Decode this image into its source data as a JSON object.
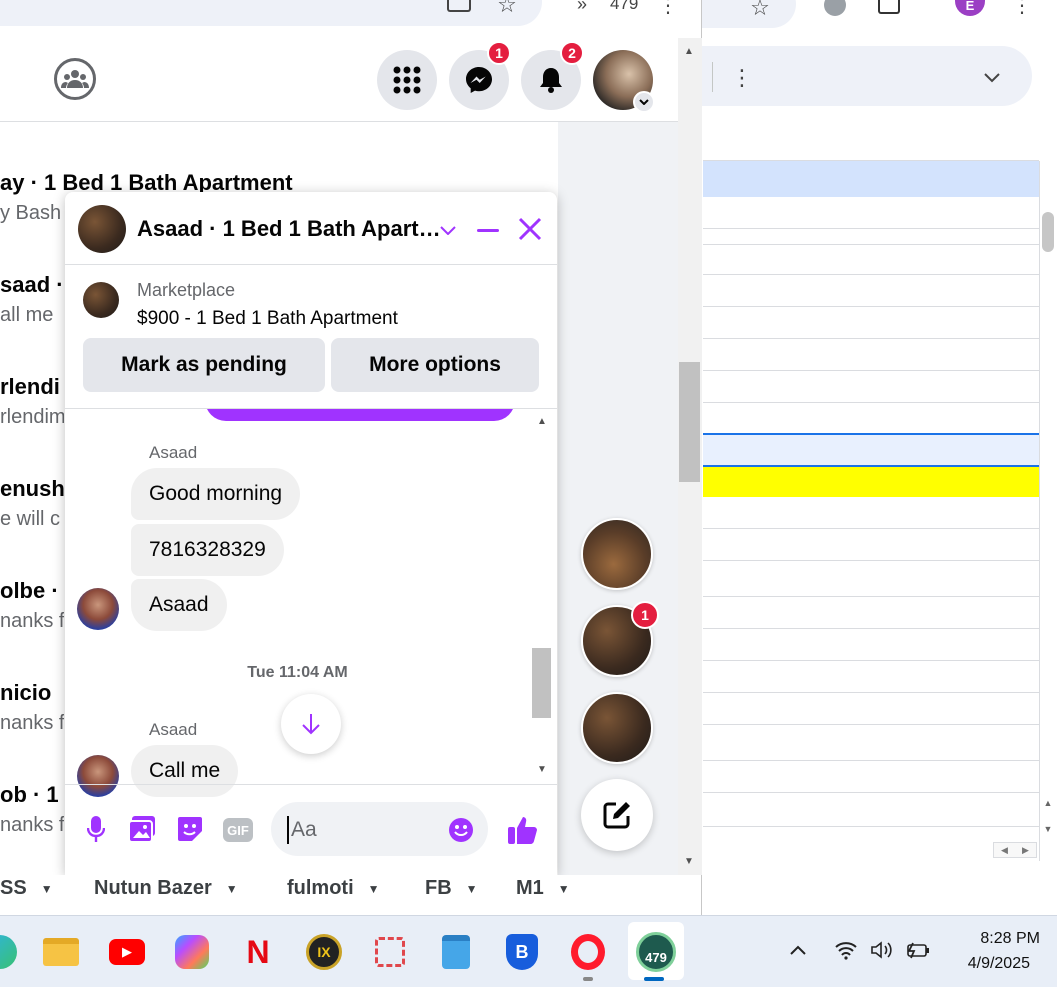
{
  "browser": {
    "tab_count": "479",
    "avatar_letter": "E"
  },
  "right_sheet": {
    "accent": "#1a73e8",
    "highlight": "#ffff00",
    "header_band": "#d3e3fd"
  },
  "messenger_list": [
    {
      "title": "ay · 1 Bed 1 Bath Apartment",
      "snippet": "y Bash"
    },
    {
      "title": "saad ·",
      "snippet": "all me"
    },
    {
      "title": "rlendi",
      "snippet": "rlendim"
    },
    {
      "title": "enush",
      "snippet": "e will c"
    },
    {
      "title": "olbe ·",
      "snippet": "nanks fo"
    },
    {
      "title": "nicio",
      "snippet": "nanks fo"
    },
    {
      "title": "ob · 1",
      "snippet": "nanks fo"
    }
  ],
  "topnav": {
    "messenger_badge": "1",
    "notifications_badge": "2"
  },
  "chat": {
    "title": "Asaad · 1 Bed 1 Bath Apart…",
    "listing_source": "Marketplace",
    "listing_title": "$900 - 1 Bed 1 Bath Apartment",
    "mark_pending": "Mark as pending",
    "more_options": "More options",
    "sender1": "Asaad",
    "msg1": "Good morning",
    "msg2": "7816328329",
    "msg3": "Asaad",
    "timestamp": "Tue 11:04 AM",
    "sender2": "Asaad",
    "msg4": "Call me",
    "input_placeholder": "Aa",
    "gif_label": "GIF",
    "accent": "#a033ff"
  },
  "chat_heads": {
    "badge": "1"
  },
  "bookmarks": [
    "SS",
    "Nutun Bazer",
    "fulmoti",
    "FB",
    "M1"
  ],
  "taskbar": {
    "time": "8:28 PM",
    "date": "4/9/2025",
    "badge": "479"
  }
}
